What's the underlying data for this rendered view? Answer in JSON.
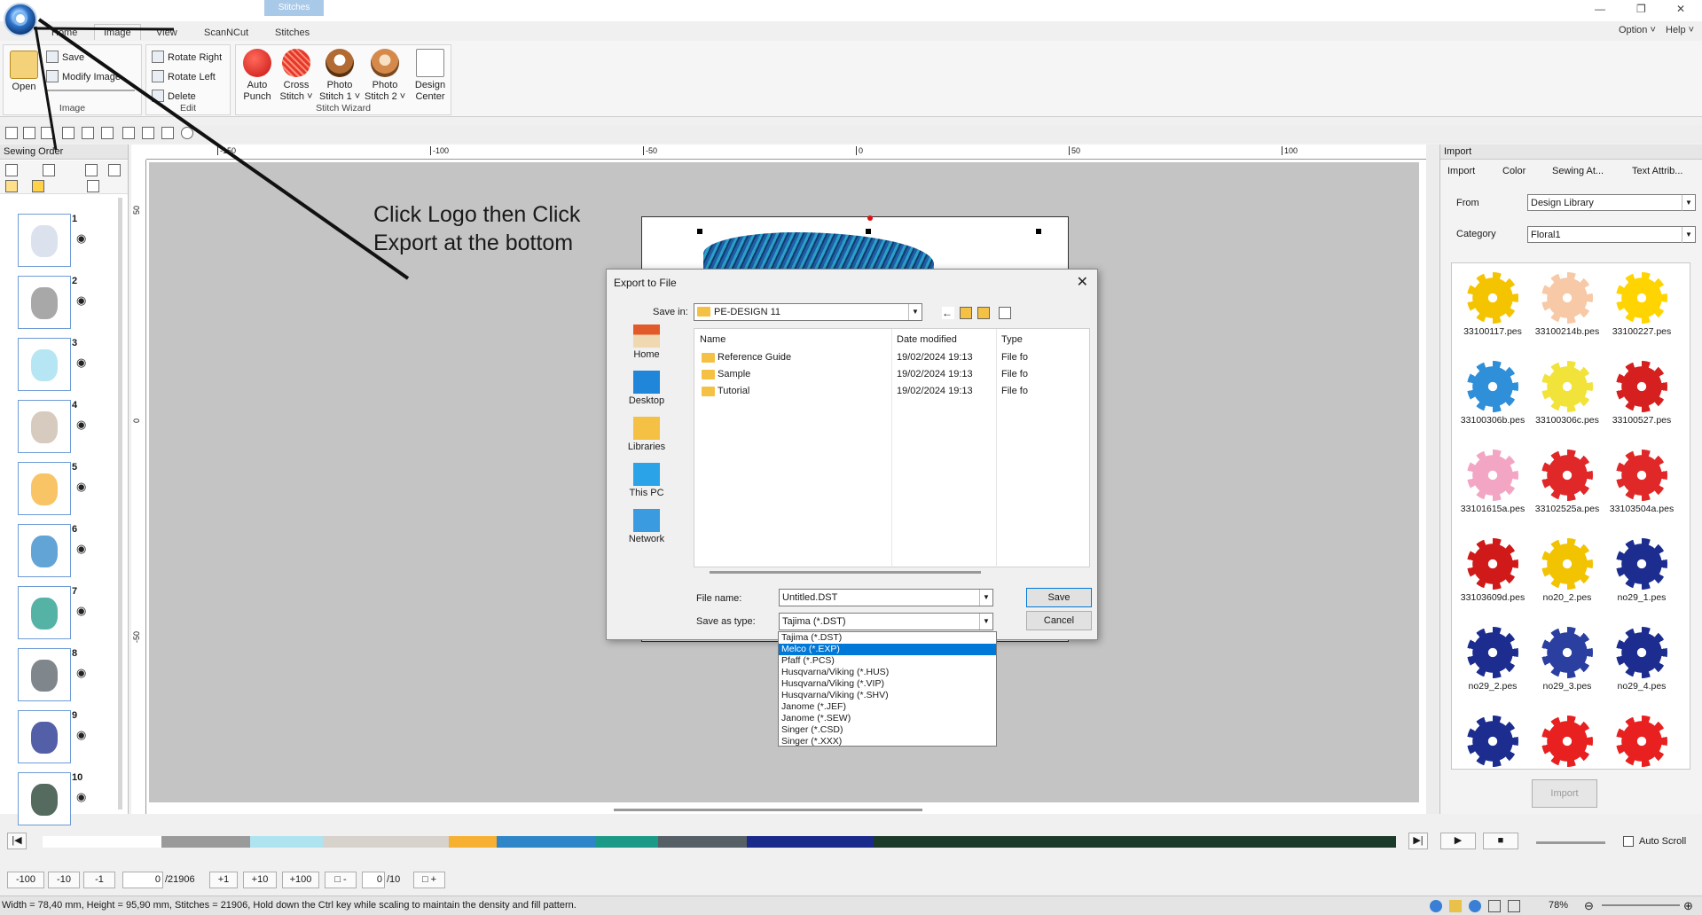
{
  "ribbon_tabs": {
    "home": "Home",
    "image": "Image",
    "view": "View",
    "scanncut": "ScanNCut",
    "stitches": "Stitches",
    "context": "Stitches"
  },
  "right_menu": {
    "option": "Option",
    "help": "Help"
  },
  "ribbon": {
    "open": "Open",
    "save": "Save",
    "modify_image": "Modify Image",
    "group_image": "Image",
    "rotate_right": "Rotate Right",
    "rotate_left": "Rotate Left",
    "delete": "Delete",
    "group_edit": "Edit",
    "auto_punch": [
      "Auto",
      "Punch"
    ],
    "cross_stitch": [
      "Cross",
      "Stitch"
    ],
    "photo_stitch_1": [
      "Photo",
      "Stitch 1"
    ],
    "photo_stitch_2": [
      "Photo",
      "Stitch 2"
    ],
    "design_center": [
      "Design",
      "Center"
    ],
    "group_wizard": "Stitch Wizard"
  },
  "sewing_order": {
    "title": "Sewing Order",
    "items": [
      "1",
      "2",
      "3",
      "4",
      "5",
      "6",
      "7",
      "8",
      "9",
      "10"
    ]
  },
  "annotation": {
    "line1": "Click Logo then Click",
    "line2": "Export at the bottom"
  },
  "rulers": {
    "top": [
      "-150",
      "-100",
      "-50",
      "0",
      "50",
      "100"
    ],
    "left": [
      "50",
      "0",
      "-50"
    ]
  },
  "dialog": {
    "title": "Export to File",
    "save_in_label": "Save in:",
    "save_in_value": "PE-DESIGN 11",
    "places": [
      "Home",
      "Desktop",
      "Libraries",
      "This PC",
      "Network"
    ],
    "columns": {
      "name": "Name",
      "date": "Date modified",
      "type": "Type"
    },
    "files": [
      {
        "name": "Reference Guide",
        "date": "19/02/2024 19:13",
        "type": "File fo"
      },
      {
        "name": "Sample",
        "date": "19/02/2024 19:13",
        "type": "File fo"
      },
      {
        "name": "Tutorial",
        "date": "19/02/2024 19:13",
        "type": "File fo"
      }
    ],
    "file_name_label": "File name:",
    "file_name_value": "Untitled.DST",
    "save_type_label": "Save as type:",
    "save_type_value": "Tajima (*.DST)",
    "save_button": "Save",
    "cancel_button": "Cancel",
    "type_options": [
      "Tajima (*.DST)",
      "Melco (*.EXP)",
      "Pfaff (*.PCS)",
      "Husqvarna/Viking (*.HUS)",
      "Husqvarna/Viking (*.VIP)",
      "Husqvarna/Viking (*.SHV)",
      "Janome (*.JEF)",
      "Janome (*.SEW)",
      "Singer (*.CSD)",
      "Singer (*.XXX)"
    ],
    "selected_option": "Melco (*.EXP)"
  },
  "import_panel": {
    "title": "Import",
    "tabs": [
      "Import",
      "Color",
      "Sewing At...",
      "Text Attrib..."
    ],
    "from_label": "From",
    "from_value": "Design Library",
    "category_label": "Category",
    "category_value": "Floral1",
    "items": [
      "33100117.pes",
      "33100214b.pes",
      "33100227.pes",
      "33100306b.pes",
      "33100306c.pes",
      "33100527.pes",
      "33101615a.pes",
      "33102525a.pes",
      "33103504a.pes",
      "33103609d.pes",
      "no20_2.pes",
      "no29_1.pes",
      "no29_2.pes",
      "no29_3.pes",
      "no29_4.pes",
      "",
      "",
      ""
    ],
    "item_colors": [
      "#f5c400",
      "#f7c9a6",
      "#ffd400",
      "#2f8fd8",
      "#f2e33a",
      "#d62020",
      "#f3a6c4",
      "#e02828",
      "#e02828",
      "#d01a1a",
      "#f2c300",
      "#1c2d8f",
      "#1c2d8f",
      "#2a3fa0",
      "#1c2d8f",
      "#1c2d8f",
      "#e82020",
      "#e82020"
    ],
    "import_button": "Import"
  },
  "color_bar": {
    "colors": [
      "#ffffff",
      "#9a9a9a",
      "#aee4f0",
      "#d8d2cc",
      "#f6b032",
      "#2e86c8",
      "#1c9a88",
      "#565f66",
      "#1a2a8a",
      "#1c3a2a"
    ]
  },
  "nav": {
    "m100": "-100",
    "m10": "-10",
    "m1": "-1",
    "stitch_current": "0",
    "stitch_total": "/21906",
    "p1": "+1",
    "p10": "+10",
    "p100": "+100",
    "frame_current": "0",
    "frame_total": "/10",
    "auto_scroll": "Auto Scroll"
  },
  "status": {
    "message": "Width = 78,40 mm, Height = 95,90 mm, Stitches = 21906, Hold down the Ctrl key while scaling to maintain the density and fill pattern.",
    "zoom": "78%"
  }
}
